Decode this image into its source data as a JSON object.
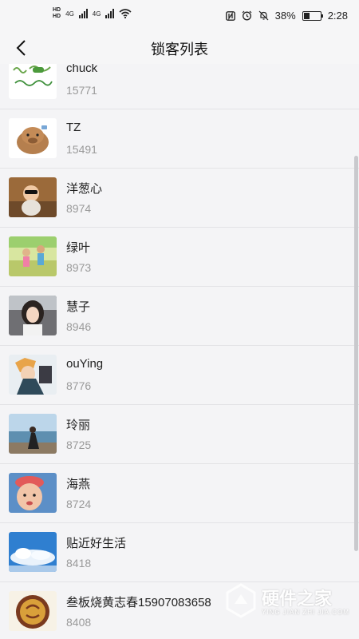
{
  "status_bar": {
    "hd1": "HD",
    "hd2": "HD",
    "net1": "4G",
    "net2": "4G",
    "battery_percent": "38%",
    "battery_level": 0.38,
    "time": "2:28",
    "icons": [
      "nfc-icon",
      "alarm-icon",
      "mute-icon",
      "battery-icon",
      "wifi-icon",
      "signal-icon"
    ]
  },
  "header": {
    "title": "锁客列表",
    "back_icon": "chevron-left-icon"
  },
  "rows": [
    {
      "name": "chuck",
      "count": "15771",
      "avatar": "handwriting-avatar"
    },
    {
      "name": "TZ",
      "count": "15491",
      "avatar": "capybara-avatar"
    },
    {
      "name": "洋葱心",
      "count": "8974",
      "avatar": "baby-sunglasses-avatar"
    },
    {
      "name": "绿叶",
      "count": "8973",
      "avatar": "children-outdoor-avatar"
    },
    {
      "name": "慧子",
      "count": "8946",
      "avatar": "woman-car-avatar"
    },
    {
      "name": "ouYing",
      "count": "8776",
      "avatar": "anime-avatar"
    },
    {
      "name": "玲丽",
      "count": "8725",
      "avatar": "beach-avatar"
    },
    {
      "name": "海燕",
      "count": "8724",
      "avatar": "child-hat-avatar"
    },
    {
      "name": "贴近好生活",
      "count": "8418",
      "avatar": "sky-clouds-avatar"
    },
    {
      "name": "叁板烧黄志春15907083658",
      "count": "8408",
      "avatar": "logo-avatar"
    }
  ],
  "colors": {
    "background": "#f2f2f4",
    "divider": "#e3e3e6",
    "count_text": "#9a9a9a"
  },
  "watermark": {
    "text": "硬件之家",
    "sub": "YING JIAN ZHI JIA.COM"
  }
}
